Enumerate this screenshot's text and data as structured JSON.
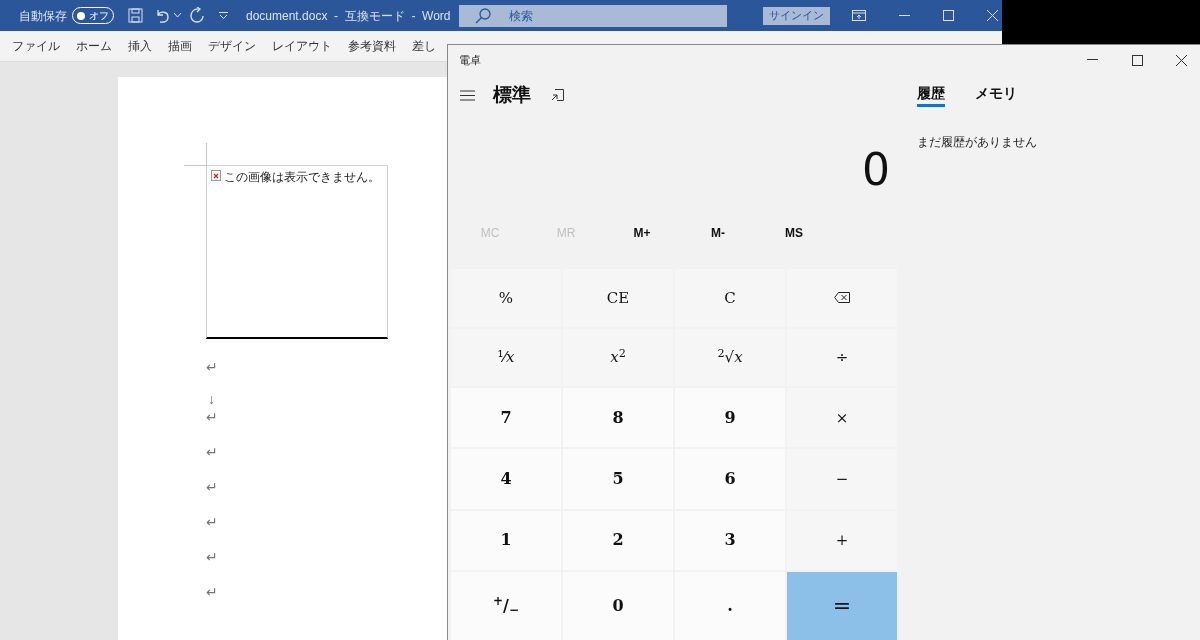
{
  "word": {
    "autosave": {
      "label": "自動保存",
      "state_label": "オフ",
      "on": false
    },
    "title": "document.docx  -  互換モード  -  Word",
    "search": {
      "placeholder": "検索"
    },
    "signin": "サインイン",
    "ribbon_tabs": [
      "ファイル",
      "ホーム",
      "挿入",
      "描画",
      "デザイン",
      "レイアウト",
      "参考資料",
      "差し"
    ],
    "document": {
      "image_error": "この画像は表示できません。",
      "marks": [
        {
          "kind": "paragraph",
          "text": "↵"
        },
        {
          "kind": "break",
          "text": "↓"
        },
        {
          "kind": "paragraph",
          "text": "↵"
        },
        {
          "kind": "paragraph",
          "text": "↵"
        },
        {
          "kind": "paragraph",
          "text": "↵"
        },
        {
          "kind": "paragraph",
          "text": "↵"
        },
        {
          "kind": "paragraph",
          "text": "↵"
        },
        {
          "kind": "paragraph",
          "text": "↵"
        }
      ]
    }
  },
  "calculator": {
    "title": "電卓",
    "mode": "標準",
    "display": "0",
    "panel_tabs": [
      {
        "label": "履歴",
        "selected": true
      },
      {
        "label": "メモリ",
        "selected": false
      }
    ],
    "history_empty": "まだ履歴がありません",
    "memory_buttons": [
      {
        "label": "MC",
        "disabled": true
      },
      {
        "label": "MR",
        "disabled": true
      },
      {
        "label": "M+",
        "disabled": false
      },
      {
        "label": "M-",
        "disabled": false
      },
      {
        "label": "MS",
        "disabled": false
      }
    ],
    "keys": [
      {
        "kind": "op",
        "label": "%"
      },
      {
        "kind": "op",
        "label": "CE"
      },
      {
        "kind": "op",
        "label": "C"
      },
      {
        "kind": "backspace"
      },
      {
        "kind": "op",
        "label": "¹⁄*x*"
      },
      {
        "kind": "op",
        "label": "*x*$^{2}$"
      },
      {
        "kind": "op",
        "label": "$^{2}$√*x*"
      },
      {
        "kind": "op",
        "label": "÷"
      },
      {
        "kind": "digit",
        "label": "7"
      },
      {
        "kind": "digit",
        "label": "8"
      },
      {
        "kind": "digit",
        "label": "9"
      },
      {
        "kind": "op",
        "label": "×"
      },
      {
        "kind": "digit",
        "label": "4"
      },
      {
        "kind": "digit",
        "label": "5"
      },
      {
        "kind": "digit",
        "label": "6"
      },
      {
        "kind": "op",
        "label": "−"
      },
      {
        "kind": "digit",
        "label": "1"
      },
      {
        "kind": "digit",
        "label": "2"
      },
      {
        "kind": "digit",
        "label": "3"
      },
      {
        "kind": "op",
        "label": "+"
      },
      {
        "kind": "digit",
        "label": "$^{+}$/$_{−}$"
      },
      {
        "kind": "digit",
        "label": "0"
      },
      {
        "kind": "digit",
        "label": "."
      },
      {
        "kind": "equals",
        "label": "="
      }
    ]
  }
}
